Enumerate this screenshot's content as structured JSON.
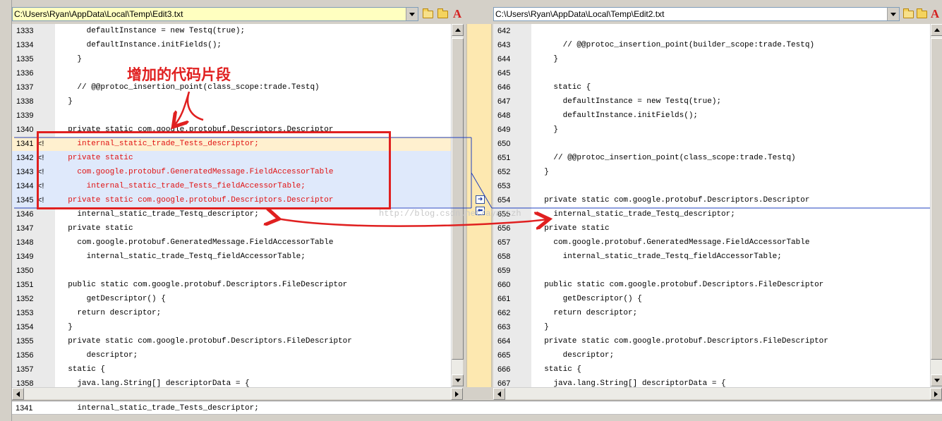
{
  "left_file": {
    "path": "C:\\Users\\Ryan\\AppData\\Local\\Temp\\Edit3.txt",
    "lines": [
      {
        "num": "1333",
        "mark": "",
        "code": "      defaultInstance = new Testq(true);",
        "state": "normal"
      },
      {
        "num": "1334",
        "mark": "",
        "code": "      defaultInstance.initFields();",
        "state": "normal"
      },
      {
        "num": "1335",
        "mark": "",
        "code": "    }",
        "state": "normal"
      },
      {
        "num": "1336",
        "mark": "",
        "code": "",
        "state": "normal"
      },
      {
        "num": "1337",
        "mark": "",
        "code": "    // @@protoc_insertion_point(class_scope:trade.Testq)",
        "state": "normal"
      },
      {
        "num": "1338",
        "mark": "",
        "code": "  }",
        "state": "normal"
      },
      {
        "num": "1339",
        "mark": "",
        "code": "",
        "state": "normal"
      },
      {
        "num": "1340",
        "mark": "",
        "code": "  private static com.google.protobuf.Descriptors.Descriptor",
        "state": "normal"
      },
      {
        "num": "1341",
        "mark": "<!",
        "code": "    internal_static_trade_Tests_descriptor;",
        "state": "current"
      },
      {
        "num": "1342",
        "mark": "<!",
        "code": "  private static",
        "state": "changed"
      },
      {
        "num": "1343",
        "mark": "<!",
        "code": "    com.google.protobuf.GeneratedMessage.FieldAccessorTable",
        "state": "changed"
      },
      {
        "num": "1344",
        "mark": "<!",
        "code": "      internal_static_trade_Tests_fieldAccessorTable;",
        "state": "changed"
      },
      {
        "num": "1345",
        "mark": "<!",
        "code": "  private static com.google.protobuf.Descriptors.Descriptor",
        "state": "changed"
      },
      {
        "num": "1346",
        "mark": "",
        "code": "    internal_static_trade_Testq_descriptor;",
        "state": "normal"
      },
      {
        "num": "1347",
        "mark": "",
        "code": "  private static",
        "state": "normal"
      },
      {
        "num": "1348",
        "mark": "",
        "code": "    com.google.protobuf.GeneratedMessage.FieldAccessorTable",
        "state": "normal"
      },
      {
        "num": "1349",
        "mark": "",
        "code": "      internal_static_trade_Testq_fieldAccessorTable;",
        "state": "normal"
      },
      {
        "num": "1350",
        "mark": "",
        "code": "",
        "state": "normal"
      },
      {
        "num": "1351",
        "mark": "",
        "code": "  public static com.google.protobuf.Descriptors.FileDescriptor",
        "state": "normal"
      },
      {
        "num": "1352",
        "mark": "",
        "code": "      getDescriptor() {",
        "state": "normal"
      },
      {
        "num": "1353",
        "mark": "",
        "code": "    return descriptor;",
        "state": "normal"
      },
      {
        "num": "1354",
        "mark": "",
        "code": "  }",
        "state": "normal"
      },
      {
        "num": "1355",
        "mark": "",
        "code": "  private static com.google.protobuf.Descriptors.FileDescriptor",
        "state": "normal"
      },
      {
        "num": "1356",
        "mark": "",
        "code": "      descriptor;",
        "state": "normal"
      },
      {
        "num": "1357",
        "mark": "",
        "code": "  static {",
        "state": "normal"
      },
      {
        "num": "1358",
        "mark": "",
        "code": "    java.lang.String[] descriptorData = {",
        "state": "normal"
      }
    ]
  },
  "right_file": {
    "path": "C:\\Users\\Ryan\\AppData\\Local\\Temp\\Edit2.txt",
    "lines": [
      {
        "num": "642",
        "mark": "",
        "code": "",
        "state": "normal"
      },
      {
        "num": "643",
        "mark": "",
        "code": "      // @@protoc_insertion_point(builder_scope:trade.Testq)",
        "state": "normal"
      },
      {
        "num": "644",
        "mark": "",
        "code": "    }",
        "state": "normal"
      },
      {
        "num": "645",
        "mark": "",
        "code": "",
        "state": "normal"
      },
      {
        "num": "646",
        "mark": "",
        "code": "    static {",
        "state": "normal"
      },
      {
        "num": "647",
        "mark": "",
        "code": "      defaultInstance = new Testq(true);",
        "state": "normal"
      },
      {
        "num": "648",
        "mark": "",
        "code": "      defaultInstance.initFields();",
        "state": "normal"
      },
      {
        "num": "649",
        "mark": "",
        "code": "    }",
        "state": "normal"
      },
      {
        "num": "650",
        "mark": "",
        "code": "",
        "state": "normal"
      },
      {
        "num": "651",
        "mark": "",
        "code": "    // @@protoc_insertion_point(class_scope:trade.Testq)",
        "state": "normal"
      },
      {
        "num": "652",
        "mark": "",
        "code": "  }",
        "state": "normal"
      },
      {
        "num": "653",
        "mark": "",
        "code": "",
        "state": "normal"
      },
      {
        "num": "654",
        "mark": "",
        "code": "  private static com.google.protobuf.Descriptors.Descriptor",
        "state": "normal"
      },
      {
        "num": "655",
        "mark": "",
        "code": "    internal_static_trade_Testq_descriptor;",
        "state": "normal"
      },
      {
        "num": "656",
        "mark": "",
        "code": "  private static",
        "state": "normal"
      },
      {
        "num": "657",
        "mark": "",
        "code": "    com.google.protobuf.GeneratedMessage.FieldAccessorTable",
        "state": "normal"
      },
      {
        "num": "658",
        "mark": "",
        "code": "      internal_static_trade_Testq_fieldAccessorTable;",
        "state": "normal"
      },
      {
        "num": "659",
        "mark": "",
        "code": "",
        "state": "normal"
      },
      {
        "num": "660",
        "mark": "",
        "code": "  public static com.google.protobuf.Descriptors.FileDescriptor",
        "state": "normal"
      },
      {
        "num": "661",
        "mark": "",
        "code": "      getDescriptor() {",
        "state": "normal"
      },
      {
        "num": "662",
        "mark": "",
        "code": "    return descriptor;",
        "state": "normal"
      },
      {
        "num": "663",
        "mark": "",
        "code": "  }",
        "state": "normal"
      },
      {
        "num": "664",
        "mark": "",
        "code": "  private static com.google.protobuf.Descriptors.FileDescriptor",
        "state": "normal"
      },
      {
        "num": "665",
        "mark": "",
        "code": "      descriptor;",
        "state": "normal"
      },
      {
        "num": "666",
        "mark": "",
        "code": "  static {",
        "state": "normal"
      },
      {
        "num": "667",
        "mark": "",
        "code": "    java.lang.String[] descriptorData = {",
        "state": "normal"
      }
    ]
  },
  "toolbar_icons": [
    "open-folder-icon",
    "folder-icon",
    "font-icon"
  ],
  "font_icon_glyph": "A",
  "nav_buttons": {
    "copy_right_glyph": "➜",
    "copy_left_glyph": "⬅"
  },
  "annotation": {
    "text": "增加的代码片段"
  },
  "watermark": {
    "text": "http://blog.csdn.net/ayaytzh"
  },
  "status": {
    "line_num": "1341",
    "line_text": "    internal_static_trade_Tests_descriptor;"
  },
  "colors": {
    "changed_bg": "#dfe9fb",
    "changed_text": "#e01010",
    "current_bg": "#fff0cf",
    "annotation": "#e02020",
    "active_path_bg": "#ffffc0",
    "middle_bar": "#fde8b0"
  }
}
